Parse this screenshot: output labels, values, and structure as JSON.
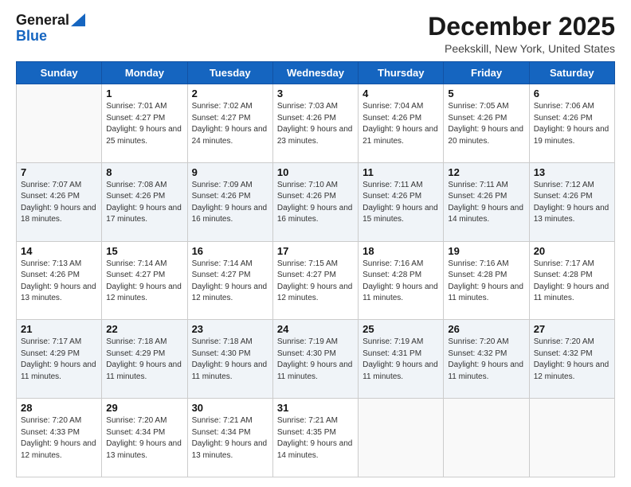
{
  "header": {
    "logo_line1": "General",
    "logo_line2": "Blue",
    "month": "December 2025",
    "location": "Peekskill, New York, United States"
  },
  "days_of_week": [
    "Sunday",
    "Monday",
    "Tuesday",
    "Wednesday",
    "Thursday",
    "Friday",
    "Saturday"
  ],
  "weeks": [
    [
      {
        "day": "",
        "sunrise": "",
        "sunset": "",
        "daylight": ""
      },
      {
        "day": "1",
        "sunrise": "Sunrise: 7:01 AM",
        "sunset": "Sunset: 4:27 PM",
        "daylight": "Daylight: 9 hours and 25 minutes."
      },
      {
        "day": "2",
        "sunrise": "Sunrise: 7:02 AM",
        "sunset": "Sunset: 4:27 PM",
        "daylight": "Daylight: 9 hours and 24 minutes."
      },
      {
        "day": "3",
        "sunrise": "Sunrise: 7:03 AM",
        "sunset": "Sunset: 4:26 PM",
        "daylight": "Daylight: 9 hours and 23 minutes."
      },
      {
        "day": "4",
        "sunrise": "Sunrise: 7:04 AM",
        "sunset": "Sunset: 4:26 PM",
        "daylight": "Daylight: 9 hours and 21 minutes."
      },
      {
        "day": "5",
        "sunrise": "Sunrise: 7:05 AM",
        "sunset": "Sunset: 4:26 PM",
        "daylight": "Daylight: 9 hours and 20 minutes."
      },
      {
        "day": "6",
        "sunrise": "Sunrise: 7:06 AM",
        "sunset": "Sunset: 4:26 PM",
        "daylight": "Daylight: 9 hours and 19 minutes."
      }
    ],
    [
      {
        "day": "7",
        "sunrise": "Sunrise: 7:07 AM",
        "sunset": "Sunset: 4:26 PM",
        "daylight": "Daylight: 9 hours and 18 minutes."
      },
      {
        "day": "8",
        "sunrise": "Sunrise: 7:08 AM",
        "sunset": "Sunset: 4:26 PM",
        "daylight": "Daylight: 9 hours and 17 minutes."
      },
      {
        "day": "9",
        "sunrise": "Sunrise: 7:09 AM",
        "sunset": "Sunset: 4:26 PM",
        "daylight": "Daylight: 9 hours and 16 minutes."
      },
      {
        "day": "10",
        "sunrise": "Sunrise: 7:10 AM",
        "sunset": "Sunset: 4:26 PM",
        "daylight": "Daylight: 9 hours and 16 minutes."
      },
      {
        "day": "11",
        "sunrise": "Sunrise: 7:11 AM",
        "sunset": "Sunset: 4:26 PM",
        "daylight": "Daylight: 9 hours and 15 minutes."
      },
      {
        "day": "12",
        "sunrise": "Sunrise: 7:11 AM",
        "sunset": "Sunset: 4:26 PM",
        "daylight": "Daylight: 9 hours and 14 minutes."
      },
      {
        "day": "13",
        "sunrise": "Sunrise: 7:12 AM",
        "sunset": "Sunset: 4:26 PM",
        "daylight": "Daylight: 9 hours and 13 minutes."
      }
    ],
    [
      {
        "day": "14",
        "sunrise": "Sunrise: 7:13 AM",
        "sunset": "Sunset: 4:26 PM",
        "daylight": "Daylight: 9 hours and 13 minutes."
      },
      {
        "day": "15",
        "sunrise": "Sunrise: 7:14 AM",
        "sunset": "Sunset: 4:27 PM",
        "daylight": "Daylight: 9 hours and 12 minutes."
      },
      {
        "day": "16",
        "sunrise": "Sunrise: 7:14 AM",
        "sunset": "Sunset: 4:27 PM",
        "daylight": "Daylight: 9 hours and 12 minutes."
      },
      {
        "day": "17",
        "sunrise": "Sunrise: 7:15 AM",
        "sunset": "Sunset: 4:27 PM",
        "daylight": "Daylight: 9 hours and 12 minutes."
      },
      {
        "day": "18",
        "sunrise": "Sunrise: 7:16 AM",
        "sunset": "Sunset: 4:28 PM",
        "daylight": "Daylight: 9 hours and 11 minutes."
      },
      {
        "day": "19",
        "sunrise": "Sunrise: 7:16 AM",
        "sunset": "Sunset: 4:28 PM",
        "daylight": "Daylight: 9 hours and 11 minutes."
      },
      {
        "day": "20",
        "sunrise": "Sunrise: 7:17 AM",
        "sunset": "Sunset: 4:28 PM",
        "daylight": "Daylight: 9 hours and 11 minutes."
      }
    ],
    [
      {
        "day": "21",
        "sunrise": "Sunrise: 7:17 AM",
        "sunset": "Sunset: 4:29 PM",
        "daylight": "Daylight: 9 hours and 11 minutes."
      },
      {
        "day": "22",
        "sunrise": "Sunrise: 7:18 AM",
        "sunset": "Sunset: 4:29 PM",
        "daylight": "Daylight: 9 hours and 11 minutes."
      },
      {
        "day": "23",
        "sunrise": "Sunrise: 7:18 AM",
        "sunset": "Sunset: 4:30 PM",
        "daylight": "Daylight: 9 hours and 11 minutes."
      },
      {
        "day": "24",
        "sunrise": "Sunrise: 7:19 AM",
        "sunset": "Sunset: 4:30 PM",
        "daylight": "Daylight: 9 hours and 11 minutes."
      },
      {
        "day": "25",
        "sunrise": "Sunrise: 7:19 AM",
        "sunset": "Sunset: 4:31 PM",
        "daylight": "Daylight: 9 hours and 11 minutes."
      },
      {
        "day": "26",
        "sunrise": "Sunrise: 7:20 AM",
        "sunset": "Sunset: 4:32 PM",
        "daylight": "Daylight: 9 hours and 11 minutes."
      },
      {
        "day": "27",
        "sunrise": "Sunrise: 7:20 AM",
        "sunset": "Sunset: 4:32 PM",
        "daylight": "Daylight: 9 hours and 12 minutes."
      }
    ],
    [
      {
        "day": "28",
        "sunrise": "Sunrise: 7:20 AM",
        "sunset": "Sunset: 4:33 PM",
        "daylight": "Daylight: 9 hours and 12 minutes."
      },
      {
        "day": "29",
        "sunrise": "Sunrise: 7:20 AM",
        "sunset": "Sunset: 4:34 PM",
        "daylight": "Daylight: 9 hours and 13 minutes."
      },
      {
        "day": "30",
        "sunrise": "Sunrise: 7:21 AM",
        "sunset": "Sunset: 4:34 PM",
        "daylight": "Daylight: 9 hours and 13 minutes."
      },
      {
        "day": "31",
        "sunrise": "Sunrise: 7:21 AM",
        "sunset": "Sunset: 4:35 PM",
        "daylight": "Daylight: 9 hours and 14 minutes."
      },
      {
        "day": "",
        "sunrise": "",
        "sunset": "",
        "daylight": ""
      },
      {
        "day": "",
        "sunrise": "",
        "sunset": "",
        "daylight": ""
      },
      {
        "day": "",
        "sunrise": "",
        "sunset": "",
        "daylight": ""
      }
    ]
  ]
}
